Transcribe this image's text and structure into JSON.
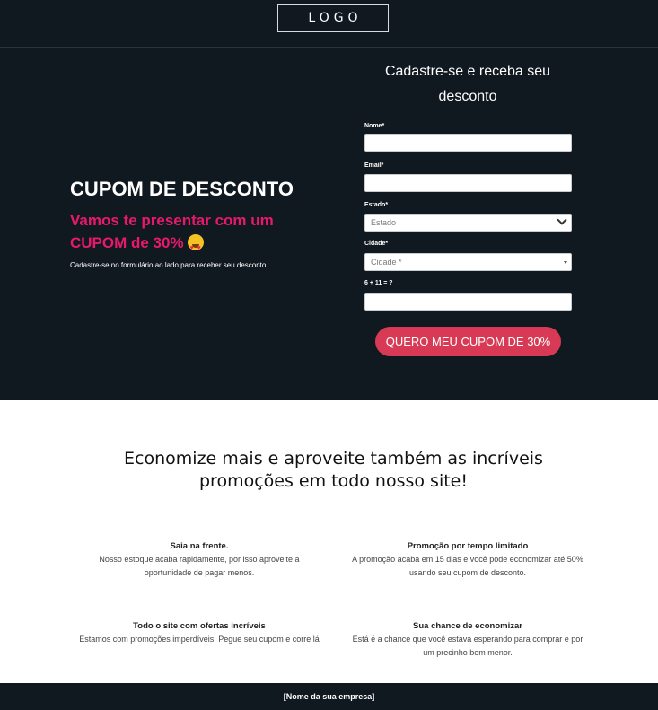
{
  "header": {
    "logo_text": "LOGO"
  },
  "hero": {
    "title": "CUPOM DE DESCONTO",
    "subtitle": "Vamos te presentar com um CUPOM de 30%",
    "emoji_icon": "heart-eyes-emoji",
    "note": "Cadastre-se no formulário ao lado para receber seu desconto."
  },
  "form": {
    "title": "Cadastre-se e receba seu desconto",
    "name_label": "Nome*",
    "email_label": "Email*",
    "state_label": "Estado*",
    "state_value": "Estado",
    "city_label": "Cidade*",
    "city_placeholder": "Cidade *",
    "captcha_label": "6 + 11 = ?",
    "submit_label": "QUERO MEU CUPOM DE 30%"
  },
  "promo": {
    "heading": "Economize mais e aproveite também as incríveis promoções em todo nosso site!",
    "features": [
      {
        "title": "Saia na frente.",
        "text": "Nosso estoque acaba rapidamente, por isso aproveite a oportunidade de pagar menos."
      },
      {
        "title": "Promoção por tempo limitado",
        "text": "A promoção acaba em 15 dias e você pode economizar até 50% usando seu cupom de desconto."
      },
      {
        "title": "Todo o site com ofertas incríveis",
        "text": "Estamos com promoções imperdíveis. Pegue seu cupom e corre lá"
      },
      {
        "title": "Sua chance de economizar",
        "text": "Está é a chance que você estava esperando para comprar e por um precinho bem menor."
      }
    ]
  },
  "footer": {
    "company": "[Nome da sua empresa]"
  },
  "colors": {
    "dark_bg": "#101820",
    "accent_pink": "#e8196d",
    "cta_red": "#d83a55"
  }
}
